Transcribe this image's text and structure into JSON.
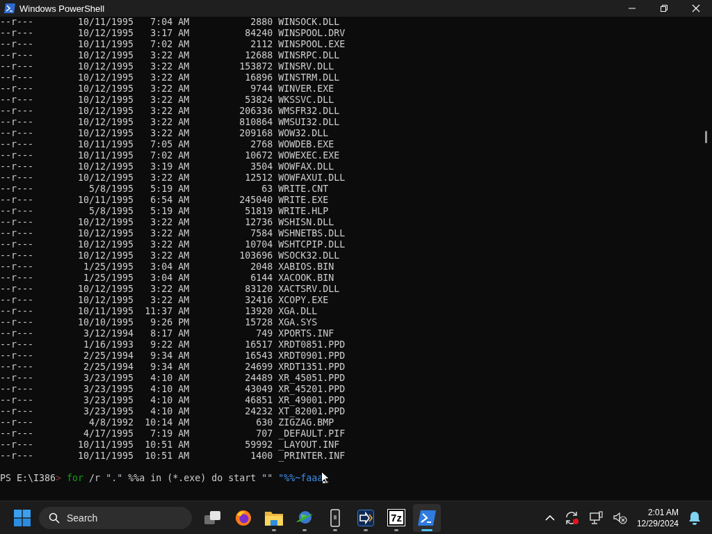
{
  "window": {
    "title": "Windows PowerShell"
  },
  "listing": [
    {
      "mode": "--r---",
      "date": "10/11/1995",
      "time": "7:04 AM",
      "length": "2880",
      "name": "WINSOCK.DLL"
    },
    {
      "mode": "--r---",
      "date": "10/12/1995",
      "time": "3:17 AM",
      "length": "84240",
      "name": "WINSPOOL.DRV"
    },
    {
      "mode": "--r---",
      "date": "10/11/1995",
      "time": "7:02 AM",
      "length": "2112",
      "name": "WINSPOOL.EXE"
    },
    {
      "mode": "--r---",
      "date": "10/12/1995",
      "time": "3:22 AM",
      "length": "12688",
      "name": "WINSRPC.DLL"
    },
    {
      "mode": "--r---",
      "date": "10/12/1995",
      "time": "3:22 AM",
      "length": "153872",
      "name": "WINSRV.DLL"
    },
    {
      "mode": "--r---",
      "date": "10/12/1995",
      "time": "3:22 AM",
      "length": "16896",
      "name": "WINSTRM.DLL"
    },
    {
      "mode": "--r---",
      "date": "10/12/1995",
      "time": "3:22 AM",
      "length": "9744",
      "name": "WINVER.EXE"
    },
    {
      "mode": "--r---",
      "date": "10/12/1995",
      "time": "3:22 AM",
      "length": "53824",
      "name": "WKSSVC.DLL"
    },
    {
      "mode": "--r---",
      "date": "10/12/1995",
      "time": "3:22 AM",
      "length": "206336",
      "name": "WMSFR32.DLL"
    },
    {
      "mode": "--r---",
      "date": "10/12/1995",
      "time": "3:22 AM",
      "length": "810864",
      "name": "WMSUI32.DLL"
    },
    {
      "mode": "--r---",
      "date": "10/12/1995",
      "time": "3:22 AM",
      "length": "209168",
      "name": "WOW32.DLL"
    },
    {
      "mode": "--r---",
      "date": "10/11/1995",
      "time": "7:05 AM",
      "length": "2768",
      "name": "WOWDEB.EXE"
    },
    {
      "mode": "--r---",
      "date": "10/11/1995",
      "time": "7:02 AM",
      "length": "10672",
      "name": "WOWEXEC.EXE"
    },
    {
      "mode": "--r---",
      "date": "10/12/1995",
      "time": "3:19 AM",
      "length": "3504",
      "name": "WOWFAX.DLL"
    },
    {
      "mode": "--r---",
      "date": "10/12/1995",
      "time": "3:22 AM",
      "length": "12512",
      "name": "WOWFAXUI.DLL"
    },
    {
      "mode": "--r---",
      "date": "5/8/1995",
      "time": "5:19 AM",
      "length": "63",
      "name": "WRITE.CNT"
    },
    {
      "mode": "--r---",
      "date": "10/11/1995",
      "time": "6:54 AM",
      "length": "245040",
      "name": "WRITE.EXE"
    },
    {
      "mode": "--r---",
      "date": "5/8/1995",
      "time": "5:19 AM",
      "length": "51819",
      "name": "WRITE.HLP"
    },
    {
      "mode": "--r---",
      "date": "10/12/1995",
      "time": "3:22 AM",
      "length": "12736",
      "name": "WSHISN.DLL"
    },
    {
      "mode": "--r---",
      "date": "10/12/1995",
      "time": "3:22 AM",
      "length": "7584",
      "name": "WSHNETBS.DLL"
    },
    {
      "mode": "--r---",
      "date": "10/12/1995",
      "time": "3:22 AM",
      "length": "10704",
      "name": "WSHTCPIP.DLL"
    },
    {
      "mode": "--r---",
      "date": "10/12/1995",
      "time": "3:22 AM",
      "length": "103696",
      "name": "WSOCK32.DLL"
    },
    {
      "mode": "--r---",
      "date": "1/25/1995",
      "time": "3:04 AM",
      "length": "2048",
      "name": "XABIOS.BIN"
    },
    {
      "mode": "--r---",
      "date": "1/25/1995",
      "time": "3:04 AM",
      "length": "6144",
      "name": "XACOOK.BIN"
    },
    {
      "mode": "--r---",
      "date": "10/12/1995",
      "time": "3:22 AM",
      "length": "83120",
      "name": "XACTSRV.DLL"
    },
    {
      "mode": "--r---",
      "date": "10/12/1995",
      "time": "3:22 AM",
      "length": "32416",
      "name": "XCOPY.EXE"
    },
    {
      "mode": "--r---",
      "date": "10/11/1995",
      "time": "11:37 AM",
      "length": "13920",
      "name": "XGA.DLL"
    },
    {
      "mode": "--r---",
      "date": "10/10/1995",
      "time": "9:26 PM",
      "length": "15728",
      "name": "XGA.SYS"
    },
    {
      "mode": "--r---",
      "date": "3/12/1994",
      "time": "8:17 AM",
      "length": "749",
      "name": "XPORTS.INF"
    },
    {
      "mode": "--r---",
      "date": "1/16/1993",
      "time": "9:22 AM",
      "length": "16517",
      "name": "XRDT0851.PPD"
    },
    {
      "mode": "--r---",
      "date": "2/25/1994",
      "time": "9:34 AM",
      "length": "16543",
      "name": "XRDT0901.PPD"
    },
    {
      "mode": "--r---",
      "date": "2/25/1994",
      "time": "9:34 AM",
      "length": "24699",
      "name": "XRDT1351.PPD"
    },
    {
      "mode": "--r---",
      "date": "3/23/1995",
      "time": "4:10 AM",
      "length": "24489",
      "name": "XR_45051.PPD"
    },
    {
      "mode": "--r---",
      "date": "3/23/1995",
      "time": "4:10 AM",
      "length": "43049",
      "name": "XR_45201.PPD"
    },
    {
      "mode": "--r---",
      "date": "3/23/1995",
      "time": "4:10 AM",
      "length": "46851",
      "name": "XR_49001.PPD"
    },
    {
      "mode": "--r---",
      "date": "3/23/1995",
      "time": "4:10 AM",
      "length": "24232",
      "name": "XT_82001.PPD"
    },
    {
      "mode": "--r---",
      "date": "4/8/1992",
      "time": "10:14 AM",
      "length": "630",
      "name": "ZIGZAG.BMP"
    },
    {
      "mode": "--r---",
      "date": "4/17/1995",
      "time": "7:19 AM",
      "length": "707",
      "name": "_DEFAULT.PIF"
    },
    {
      "mode": "--r---",
      "date": "10/11/1995",
      "time": "10:51 AM",
      "length": "59992",
      "name": "_LAYOUT.INF"
    },
    {
      "mode": "--r---",
      "date": "10/11/1995",
      "time": "10:51 AM",
      "length": "1400",
      "name": "_PRINTER.INF"
    }
  ],
  "prompt": {
    "path": "PS E:\\I386",
    "mark": ">",
    "command": [
      {
        "kind": "keyword",
        "text": "for"
      },
      {
        "kind": "plain",
        "text": "/r"
      },
      {
        "kind": "string",
        "text": "\".\""
      },
      {
        "kind": "plain",
        "text": "%%a in (*.exe) do start"
      },
      {
        "kind": "string",
        "text": "\"\""
      },
      {
        "kind": "open-string",
        "text": "\"%%~faaa"
      }
    ]
  },
  "taskbar": {
    "search": {
      "placeholder": "Search"
    },
    "apps": [
      {
        "kind": "task-view",
        "running": false,
        "selected": false
      },
      {
        "kind": "browser",
        "running": false,
        "selected": false
      },
      {
        "kind": "folder",
        "running": true,
        "selected": false
      },
      {
        "kind": "globe",
        "running": true,
        "selected": false
      },
      {
        "kind": "phone",
        "running": true,
        "selected": false
      },
      {
        "kind": "remote",
        "running": true,
        "selected": false
      },
      {
        "kind": "archive",
        "label": "7z",
        "running": true,
        "selected": false
      },
      {
        "kind": "terminal",
        "running": true,
        "selected": true
      }
    ],
    "clock": {
      "time": "2:01 AM",
      "date": "12/29/2024"
    }
  }
}
